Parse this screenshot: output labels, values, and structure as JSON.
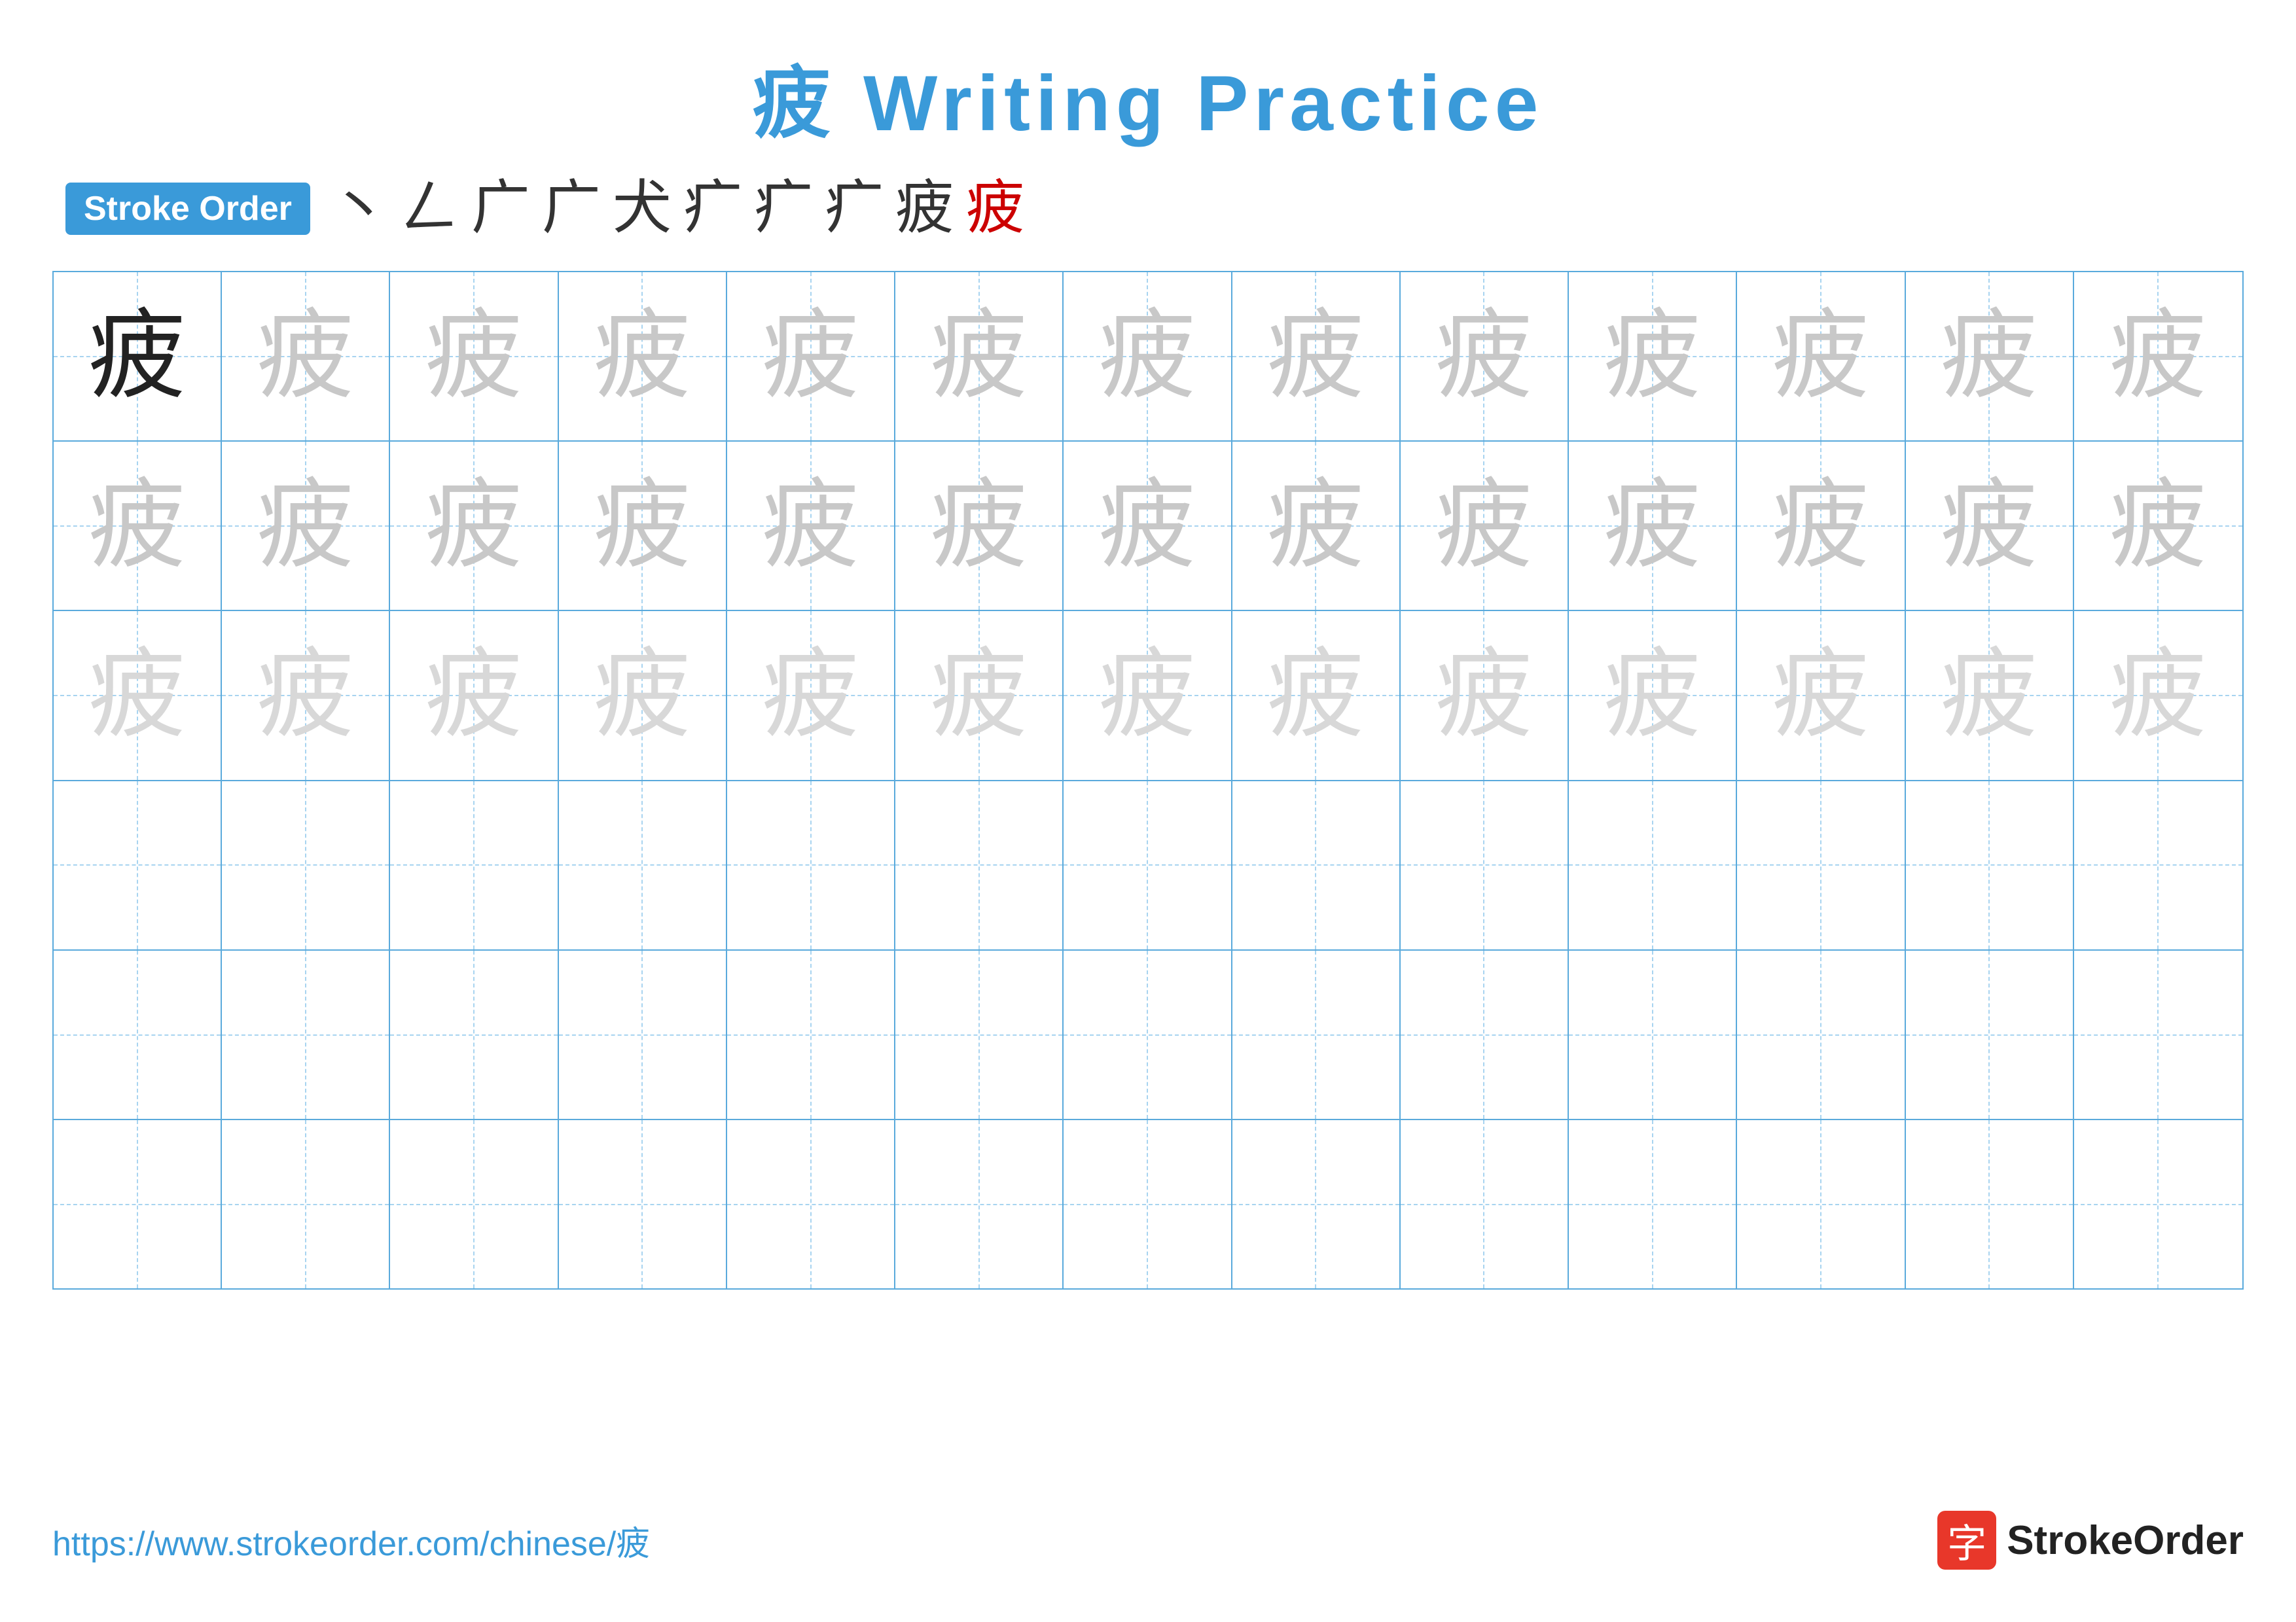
{
  "title": "疲 Writing Practice",
  "stroke_order": {
    "badge_label": "Stroke Order",
    "strokes": [
      "丶",
      "𠃋",
      "广",
      "广",
      "犬",
      "疒",
      "疒",
      "疒",
      "疲",
      "疲"
    ],
    "stroke_colors": [
      "black",
      "black",
      "black",
      "black",
      "black",
      "black",
      "black",
      "black",
      "black",
      "red"
    ]
  },
  "character": "疲",
  "grid": {
    "rows": 6,
    "cols": 13,
    "row_configs": [
      {
        "type": "dark_then_light1",
        "dark_count": 1
      },
      {
        "type": "all_light1"
      },
      {
        "type": "all_light2"
      },
      {
        "type": "empty"
      },
      {
        "type": "empty"
      },
      {
        "type": "empty"
      }
    ]
  },
  "footer": {
    "url": "https://www.strokeorder.com/chinese/疲",
    "logo_icon": "字",
    "logo_text": "StrokeOrder"
  }
}
